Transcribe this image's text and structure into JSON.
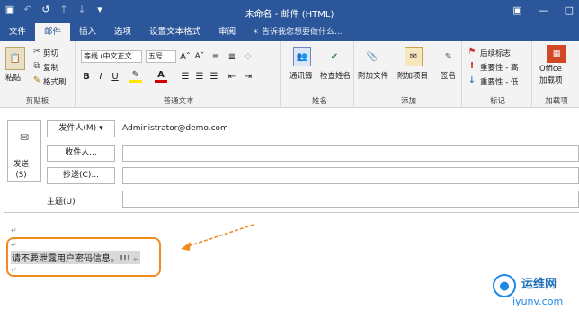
{
  "window": {
    "title": "未命名 - 邮件 (HTML)",
    "qat_icons": [
      "save-icon",
      "undo-icon",
      "redo-icon",
      "up-icon",
      "down-icon",
      "qat-more-icon"
    ],
    "controls": [
      "restore-icon",
      "minimize-icon",
      "maximize-icon"
    ]
  },
  "tabs": [
    {
      "label": "文件",
      "active": false
    },
    {
      "label": "邮件",
      "active": true
    },
    {
      "label": "插入",
      "active": false
    },
    {
      "label": "选项",
      "active": false
    },
    {
      "label": "设置文本格式",
      "active": false
    },
    {
      "label": "审阅",
      "active": false
    }
  ],
  "tellme": "告诉我您想要做什么...",
  "ribbon": {
    "clipboard": {
      "paste": "粘贴",
      "cut": "剪切",
      "copy": "复制",
      "format_painter": "格式刷",
      "label": "剪贴板"
    },
    "basic_text": {
      "font": "等线 (中文正文",
      "size": "五号",
      "label": "普通文本"
    },
    "names": {
      "address_book": "通讯簿",
      "check_names": "检查姓名",
      "label": "姓名"
    },
    "include": {
      "attach_file": "附加文件",
      "attach_item": "附加项目",
      "signature": "签名",
      "label": "添加"
    },
    "tags": {
      "follow_up": "后续标志",
      "high": "重要性 - 高",
      "low": "重要性 - 低",
      "label": "标记"
    },
    "addins": {
      "office": "Office",
      "addins": "加载项",
      "label": "加载项"
    }
  },
  "compose": {
    "send_label": "发送\n(S)",
    "from_button": "发件人(M)",
    "from_value": "Administrator@demo.com",
    "to_button": "收件人...",
    "cc_button": "抄送(C)...",
    "subject_label": "主题(U)"
  },
  "body": {
    "text": "请不要泄露用户密码信息。!!!",
    "paragraph_mark": "↵"
  },
  "watermark": {
    "line1": "运维网",
    "line2": "iyunv.com"
  },
  "colors": {
    "accent": "#2b579a",
    "annotation": "#f08c1f"
  }
}
